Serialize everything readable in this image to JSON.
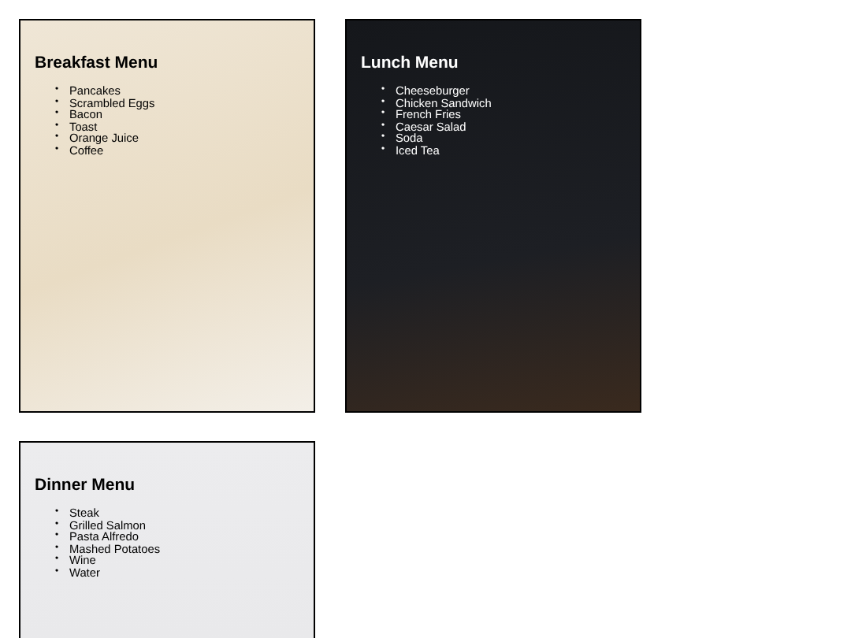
{
  "menus": [
    {
      "title": "Breakfast Menu",
      "kind": "light",
      "bullet": "•",
      "items": [
        "Pancakes",
        "Scrambled Eggs",
        "Bacon",
        "Toast",
        "Orange Juice",
        "Coffee"
      ]
    },
    {
      "title": "Lunch Menu",
      "kind": "dark",
      "bullet": "•",
      "items": [
        "Cheeseburger",
        "Chicken Sandwich",
        "French Fries",
        "Caesar Salad",
        "Soda",
        "Iced Tea"
      ]
    },
    {
      "title": "Dinner Menu",
      "kind": "light",
      "bullet": "•",
      "items": [
        "Steak",
        "Grilled Salmon",
        "Pasta Alfredo",
        "Mashed Potatoes",
        "Wine",
        "Water"
      ]
    }
  ]
}
